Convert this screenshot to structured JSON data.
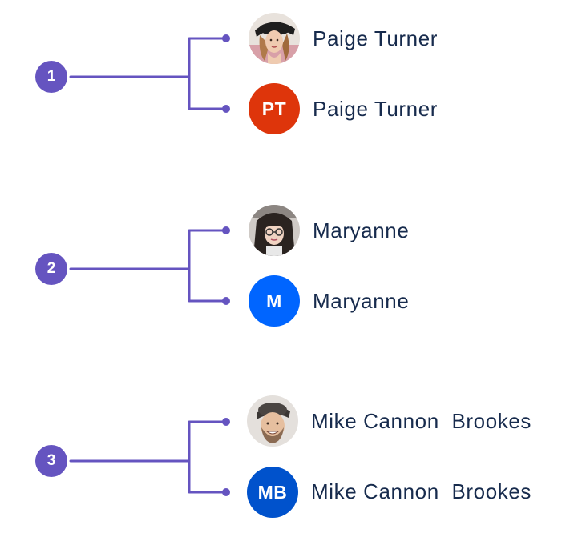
{
  "colors": {
    "accent": "#6554C0",
    "text": "#172B4D",
    "initials_red": "#DE350B",
    "initials_blue": "#0065FF",
    "initials_darkblue": "#0052CC"
  },
  "groups": [
    {
      "number": "1",
      "photo_row": {
        "name": "Paige Turner",
        "icon": "woman-with-hat-photo-avatar"
      },
      "initials_row": {
        "name": "Paige Turner",
        "initials": "PT",
        "color": "#DE350B"
      }
    },
    {
      "number": "2",
      "photo_row": {
        "name": "Maryanne",
        "icon": "woman-with-glasses-photo-avatar"
      },
      "initials_row": {
        "name": "Maryanne",
        "initials": "M",
        "color": "#0065FF"
      }
    },
    {
      "number": "3",
      "photo_row": {
        "name": "Mike Cannon  Brookes",
        "icon": "man-with-cap-photo-avatar"
      },
      "initials_row": {
        "name": "Mike Cannon  Brookes",
        "initials": "MB",
        "color": "#0052CC"
      }
    }
  ]
}
